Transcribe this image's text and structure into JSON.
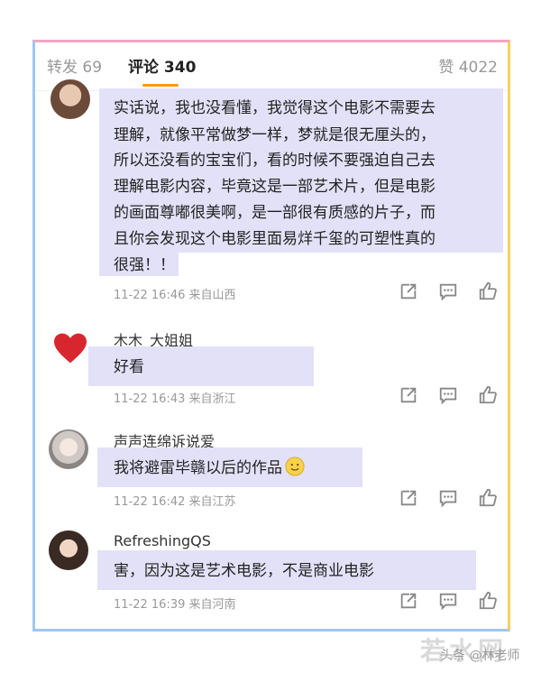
{
  "tabs": {
    "repost": "转发 69",
    "comments": "评论 340",
    "likes": "赞 4022"
  },
  "comments": [
    {
      "username": "",
      "lines": [
        "实话说，我也没看懂，我觉得这个电影不需要去",
        "理解，就像平常做梦一样，梦就是很无厘头的，",
        "所以还没看的宝宝们，看的时候不要强迫自己去",
        "理解电影内容，毕竟这是一部艺术片，但是电影",
        "的画面尊嘟很美啊，是一部很有质感的片子，而",
        "且你会发现这个电影里面易烊千玺的可塑性真的",
        "很强！！"
      ],
      "meta": "11-22 16:46  来自山西"
    },
    {
      "username": "木木_大姐姐",
      "lines": [
        "好看"
      ],
      "meta": "11-22 16:43  来自浙江"
    },
    {
      "username": "声声连绵诉说爱",
      "lines": [
        "我将避雷毕赣以后的作品"
      ],
      "meta": "11-22 16:42  来自江苏"
    },
    {
      "username": "RefreshingQS",
      "lines": [
        "害，因为这是艺术电影，不是商业电影"
      ],
      "meta": "11-22 16:39  来自河南"
    }
  ],
  "watermark": {
    "site": "若水网",
    "credit": "头条 @林老师"
  },
  "colors": {
    "accent": "#f39c12",
    "highlight": "#e3e1f8",
    "heart": "#d8262f"
  }
}
